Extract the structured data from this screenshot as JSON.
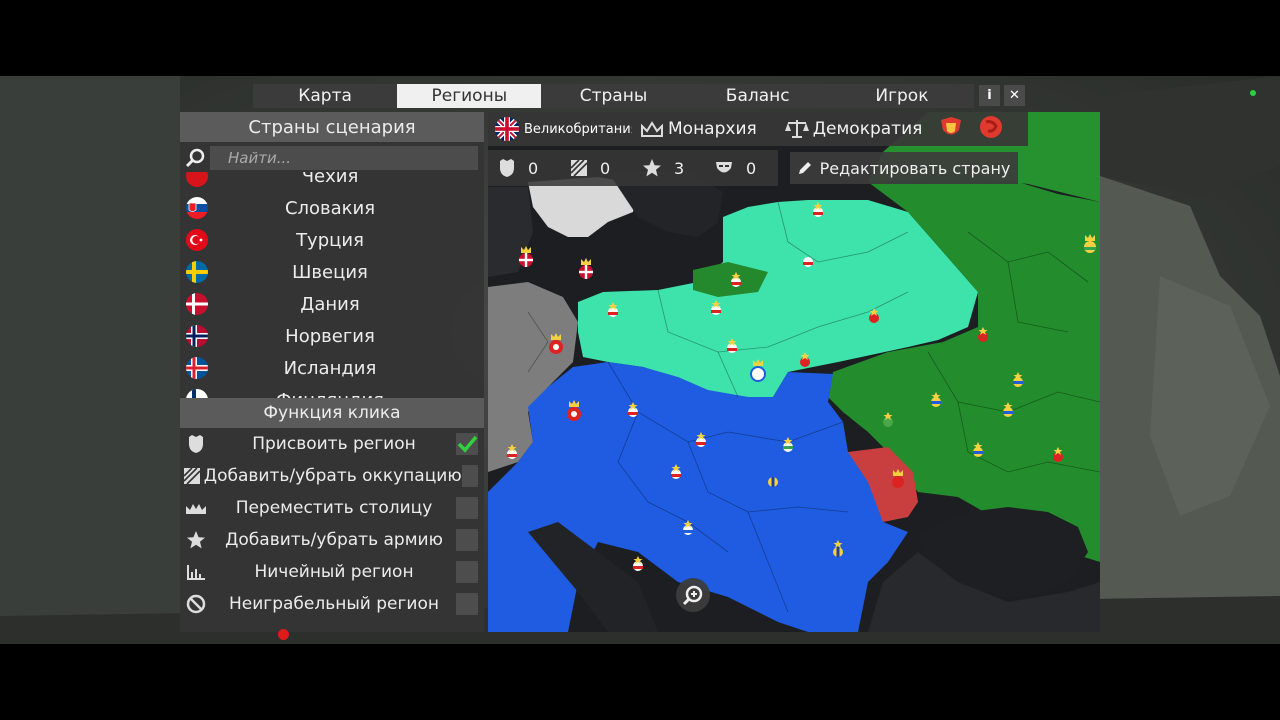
{
  "colors": {
    "accent_green": "#27d13f",
    "player_blue": "#1e5ce0",
    "teal_country": "#3be3a9",
    "green_country": "#238c2d",
    "red_country": "#c93d3d",
    "gray_country": "#7b7b7b"
  },
  "tabs": [
    {
      "label": "Карта",
      "active": false
    },
    {
      "label": "Регионы",
      "active": true
    },
    {
      "label": "Страны",
      "active": false
    },
    {
      "label": "Баланс",
      "active": false
    },
    {
      "label": "Игрок",
      "active": false
    }
  ],
  "top_icons": [
    {
      "icon": "info-icon",
      "glyph": "i"
    },
    {
      "icon": "close-icon",
      "glyph": "✕"
    }
  ],
  "left_panel": {
    "title": "Страны сценария",
    "search_placeholder": "Найти...",
    "countries": [
      {
        "name": "Чехия",
        "flag": "cz-flag-icon"
      },
      {
        "name": "Словакия",
        "flag": "sk-flag-icon"
      },
      {
        "name": "Турция",
        "flag": "tr-flag-icon"
      },
      {
        "name": "Швеция",
        "flag": "se-flag-icon"
      },
      {
        "name": "Дания",
        "flag": "dk-flag-icon"
      },
      {
        "name": "Норвегия",
        "flag": "no-flag-icon"
      },
      {
        "name": "Исландия",
        "flag": "is-flag-icon"
      },
      {
        "name": "Финляндия",
        "flag": "fi-flag-icon"
      }
    ],
    "click_function_title": "Функция клика",
    "functions": [
      {
        "label": "Присвоить регион",
        "icon": "shield-icon",
        "checked": true
      },
      {
        "label": "Добавить/убрать оккупацию",
        "icon": "occupation-icon",
        "checked": false
      },
      {
        "label": "Переместить столицу",
        "icon": "crown-icon",
        "checked": false
      },
      {
        "label": "Добавить/убрать армию",
        "icon": "star-icon",
        "checked": false
      },
      {
        "label": "Ничейный регион",
        "icon": "neutral-icon",
        "checked": false
      },
      {
        "label": "Неиграбельный регион",
        "icon": "forbidden-icon",
        "checked": false
      }
    ]
  },
  "country_bar": {
    "country_name": "Великобритания",
    "flag": "uk-flag-icon",
    "government": "Монархия",
    "ideology": "Демократия"
  },
  "stats": [
    {
      "icon": "shield-icon",
      "value": "0"
    },
    {
      "icon": "occupation-icon",
      "value": "0"
    },
    {
      "icon": "star-icon",
      "value": "3"
    },
    {
      "icon": "mask-icon",
      "value": "0"
    }
  ],
  "edit_button": "Редактировать страну"
}
